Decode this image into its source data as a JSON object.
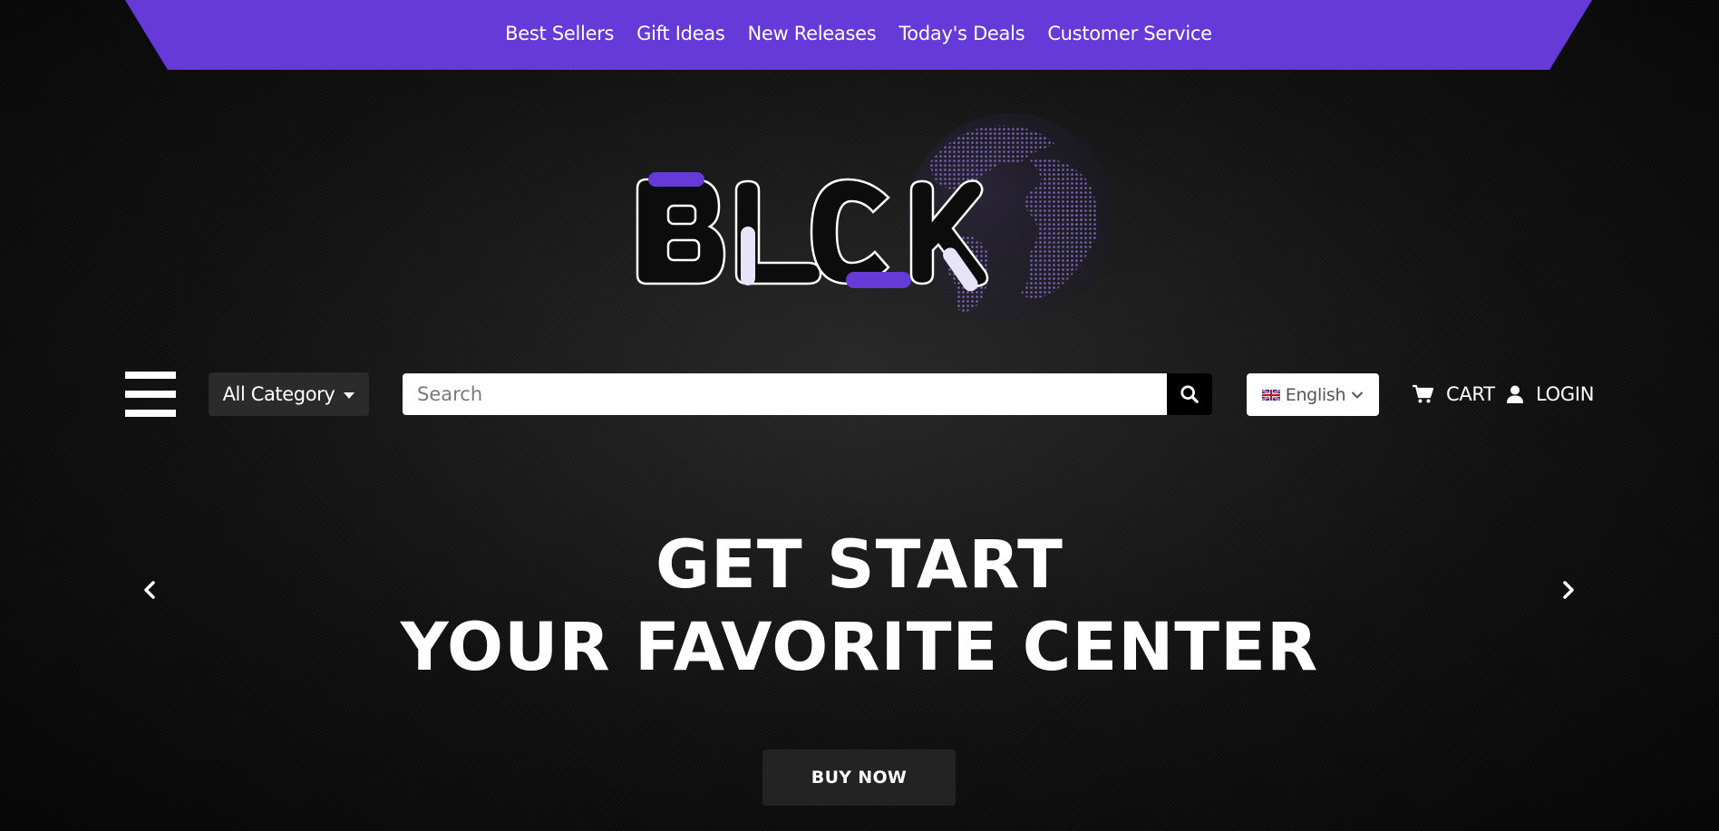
{
  "top_nav": {
    "items": [
      {
        "label": "Best Sellers"
      },
      {
        "label": "Gift Ideas"
      },
      {
        "label": "New Releases"
      },
      {
        "label": "Today's Deals"
      },
      {
        "label": "Customer Service"
      }
    ],
    "background_color": "#6639d9"
  },
  "logo": {
    "text": "BLCK",
    "accent_color": "#6639d9",
    "globe_color": "#7a63b8"
  },
  "search_bar": {
    "category_label": "All Category",
    "search_placeholder": "Search",
    "search_value": "",
    "language_label": "English",
    "cart_label": "CART",
    "login_label": "LOGIN"
  },
  "hero": {
    "title_line1": "GET START",
    "title_line2": "YOUR FAVORITE CENTER",
    "button_label": "BUY NOW"
  },
  "icons": [
    "hamburger-menu-icon",
    "search-icon",
    "uk-flag-icon",
    "chevron-down-icon",
    "cart-icon",
    "user-icon",
    "chevron-left-icon",
    "chevron-right-icon"
  ]
}
